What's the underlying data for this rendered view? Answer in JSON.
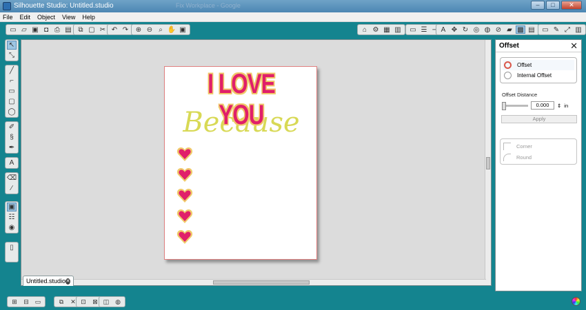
{
  "window": {
    "title": "Silhouette Studio: Untitled.studio",
    "ghost_tab": "Fix Workplace - Google",
    "min": "–",
    "max": "□",
    "close": "✕"
  },
  "menu": [
    "File",
    "Edit",
    "Object",
    "View",
    "Help"
  ],
  "toolbar": {
    "icons_left": [
      "new-icon",
      "open-icon",
      "save-icon",
      "save-as-icon",
      "print-icon",
      "cut-print-icon",
      "copy-icon",
      "paste-icon",
      "cut-icon",
      "undo-icon",
      "redo-icon",
      "zoom-in-icon",
      "zoom-out-icon",
      "zoom-select-icon",
      "pan-icon",
      "fit-page-icon"
    ],
    "icons_right": [
      "page-setup-icon",
      "grid-icon",
      "align-icon",
      "replicate-icon",
      "group-icon",
      "ungroup-icon",
      "weld-icon",
      "text-style-icon",
      "transform-icon",
      "rotate-icon",
      "offset-icon",
      "knife-icon",
      "line-style-icon",
      "fill-icon",
      "cut-settings-icon",
      "store-icon",
      "eraser-icon",
      "fullscreen-icon",
      "panel-icon"
    ]
  },
  "design": {
    "headline": "I LOVE YOU",
    "subhead": "Because",
    "heart_count": 5,
    "colors": {
      "pink": "#e01f6a",
      "gold": "#f0c96a",
      "yellow_green": "#d8d955"
    }
  },
  "doc_tab": {
    "label": "Untitled.studio",
    "close": "✕"
  },
  "panel": {
    "title": "Offset",
    "close": "✕",
    "options": [
      "Offset",
      "Internal Offset"
    ],
    "distance_label": "Offset Distance",
    "distance_value": "0.000",
    "distance_unit": "in",
    "apply_label": "Apply",
    "corner_options": [
      "Corner",
      "Round"
    ]
  },
  "accent": "#14848f"
}
